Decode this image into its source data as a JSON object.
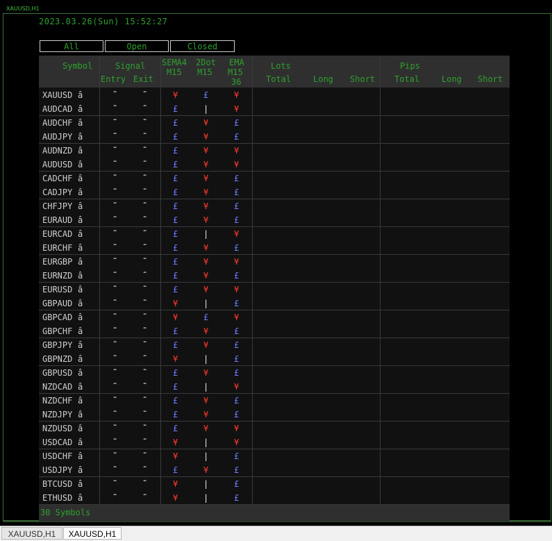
{
  "window": {
    "chart_title": "XAUUSD,H1",
    "datetime": "2023.03.26(Sun) 15:52:27"
  },
  "filters": [
    {
      "label": "All"
    },
    {
      "label": "Open"
    },
    {
      "label": "Closed"
    }
  ],
  "headers": {
    "symbol": "Symbol",
    "signal": "Signal",
    "entry": "Entry",
    "exit": "Exit",
    "sema_1": "SEMA4",
    "sema_2": "M15",
    "dot_1": "2Dot",
    "dot_2": "M15",
    "ema_1": "EMA",
    "ema_2": "M15",
    "ema_3": "36",
    "lots": "Lots",
    "lots_total": "Total",
    "lots_long": "Long",
    "lots_short": "Short",
    "pips": "Pips",
    "pips_total": "Total",
    "pips_long": "Long",
    "pips_short": "Short"
  },
  "symbol_arrow": "â",
  "rows": [
    {
      "symbol": "XAUUSD",
      "entry": "˜",
      "exit": "˜",
      "sema": "¥",
      "dot": "£",
      "ema": "¥"
    },
    {
      "symbol": "AUDCAD",
      "entry": "˜",
      "exit": "˜",
      "sema": "£",
      "dot": "|",
      "ema": "¥"
    },
    {
      "symbol": "AUDCHF",
      "entry": "˜",
      "exit": "˜",
      "sema": "£",
      "dot": "¥",
      "ema": "£"
    },
    {
      "symbol": "AUDJPY",
      "entry": "˜",
      "exit": "˜",
      "sema": "£",
      "dot": "¥",
      "ema": "£"
    },
    {
      "symbol": "AUDNZD",
      "entry": "˜",
      "exit": "˜",
      "sema": "£",
      "dot": "¥",
      "ema": "¥"
    },
    {
      "symbol": "AUDUSD",
      "entry": "˜",
      "exit": "˜",
      "sema": "£",
      "dot": "¥",
      "ema": "¥"
    },
    {
      "symbol": "CADCHF",
      "entry": "˜",
      "exit": "˜",
      "sema": "£",
      "dot": "¥",
      "ema": "£"
    },
    {
      "symbol": "CADJPY",
      "entry": "˜",
      "exit": "˜",
      "sema": "£",
      "dot": "¥",
      "ema": "£"
    },
    {
      "symbol": "CHFJPY",
      "entry": "˜",
      "exit": "˜",
      "sema": "£",
      "dot": "¥",
      "ema": "£"
    },
    {
      "symbol": "EURAUD",
      "entry": "˜",
      "exit": "˜",
      "sema": "£",
      "dot": "¥",
      "ema": "£"
    },
    {
      "symbol": "EURCAD",
      "entry": "˜",
      "exit": "˜",
      "sema": "£",
      "dot": "|",
      "ema": "¥"
    },
    {
      "symbol": "EURCHF",
      "entry": "˜",
      "exit": "˜",
      "sema": "£",
      "dot": "¥",
      "ema": "£"
    },
    {
      "symbol": "EURGBP",
      "entry": "˜",
      "exit": "˜",
      "sema": "£",
      "dot": "¥",
      "ema": "¥"
    },
    {
      "symbol": "EURNZD",
      "entry": "˜",
      "exit": "˜",
      "sema": "£",
      "dot": "¥",
      "ema": "£"
    },
    {
      "symbol": "EURUSD",
      "entry": "˜",
      "exit": "˜",
      "sema": "£",
      "dot": "¥",
      "ema": "¥"
    },
    {
      "symbol": "GBPAUD",
      "entry": "˜",
      "exit": "˜",
      "sema": "¥",
      "dot": "|",
      "ema": "£"
    },
    {
      "symbol": "GBPCAD",
      "entry": "˜",
      "exit": "˜",
      "sema": "¥",
      "dot": "£",
      "ema": "¥"
    },
    {
      "symbol": "GBPCHF",
      "entry": "˜",
      "exit": "˜",
      "sema": "£",
      "dot": "¥",
      "ema": "£"
    },
    {
      "symbol": "GBPJPY",
      "entry": "˜",
      "exit": "˜",
      "sema": "£",
      "dot": "¥",
      "ema": "£"
    },
    {
      "symbol": "GBPNZD",
      "entry": "˜",
      "exit": "˜",
      "sema": "¥",
      "dot": "|",
      "ema": "£"
    },
    {
      "symbol": "GBPUSD",
      "entry": "˜",
      "exit": "˜",
      "sema": "£",
      "dot": "¥",
      "ema": "£"
    },
    {
      "symbol": "NZDCAD",
      "entry": "˜",
      "exit": "˜",
      "sema": "£",
      "dot": "|",
      "ema": "¥"
    },
    {
      "symbol": "NZDCHF",
      "entry": "˜",
      "exit": "˜",
      "sema": "£",
      "dot": "¥",
      "ema": "£"
    },
    {
      "symbol": "NZDJPY",
      "entry": "˜",
      "exit": "˜",
      "sema": "£",
      "dot": "¥",
      "ema": "£"
    },
    {
      "symbol": "NZDUSD",
      "entry": "˜",
      "exit": "˜",
      "sema": "£",
      "dot": "¥",
      "ema": "¥"
    },
    {
      "symbol": "USDCAD",
      "entry": "˜",
      "exit": "˜",
      "sema": "¥",
      "dot": "|",
      "ema": "¥"
    },
    {
      "symbol": "USDCHF",
      "entry": "˜",
      "exit": "˜",
      "sema": "¥",
      "dot": "|",
      "ema": "£"
    },
    {
      "symbol": "USDJPY",
      "entry": "˜",
      "exit": "˜",
      "sema": "£",
      "dot": "¥",
      "ema": "£"
    },
    {
      "symbol": "BTCUSD",
      "entry": "˜",
      "exit": "˜",
      "sema": "¥",
      "dot": "|",
      "ema": "£"
    },
    {
      "symbol": "ETHUSD",
      "entry": "˜",
      "exit": "˜",
      "sema": "¥",
      "dot": "|",
      "ema": "£"
    }
  ],
  "footer": {
    "symbols_count": "30 Symbols"
  },
  "window_tabs": [
    {
      "label": "XAUUSD,H1"
    },
    {
      "label": "XAUUSD,H1"
    }
  ],
  "colors": {
    "bullish": "#ff3b30",
    "bearish": "#6b7bff",
    "neutral": "#e8e8e8",
    "text_green": "#2fa02f"
  }
}
